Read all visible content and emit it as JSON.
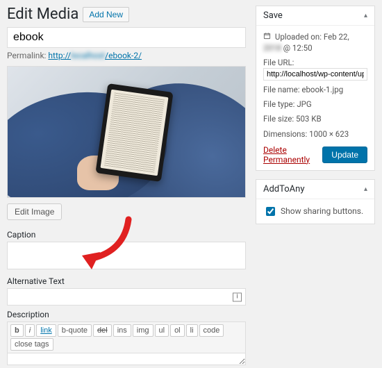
{
  "header": {
    "title": "Edit Media",
    "add_new_label": "Add New"
  },
  "media": {
    "title_value": "ebook",
    "permalink_label": "Permalink:",
    "permalink_prefix": "http://",
    "permalink_host": "localhost",
    "permalink_suffix": "/ebook-2/"
  },
  "buttons": {
    "edit_image": "Edit Image"
  },
  "fields": {
    "caption_label": "Caption",
    "alt_label": "Alternative Text",
    "desc_label": "Description",
    "caption_value": "",
    "alt_value": "",
    "desc_value": ""
  },
  "qt": [
    "b",
    "i",
    "link",
    "b-quote",
    "del",
    "ins",
    "img",
    "ul",
    "ol",
    "li",
    "code",
    "close tags"
  ],
  "savebox": {
    "title": "Save",
    "uploaded_label": "Uploaded on:",
    "uploaded_value": "Feb 22,",
    "uploaded_year": "2018",
    "uploaded_time": "@ 12:50",
    "file_url_label": "File URL:",
    "file_url_value": "http://localhost/wp-content/uploads",
    "filename_label": "File name:",
    "filename_value": "ebook-1.jpg",
    "filetype_label": "File type:",
    "filetype_value": "JPG",
    "filesize_label": "File size:",
    "filesize_value": "503 KB",
    "dimensions_label": "Dimensions:",
    "dimensions_value": "1000 × 623",
    "delete_label": "Delete Permanently",
    "update_label": "Update"
  },
  "addtoany": {
    "title": "AddToAny",
    "checkbox_label": "Show sharing buttons.",
    "checked": true
  }
}
